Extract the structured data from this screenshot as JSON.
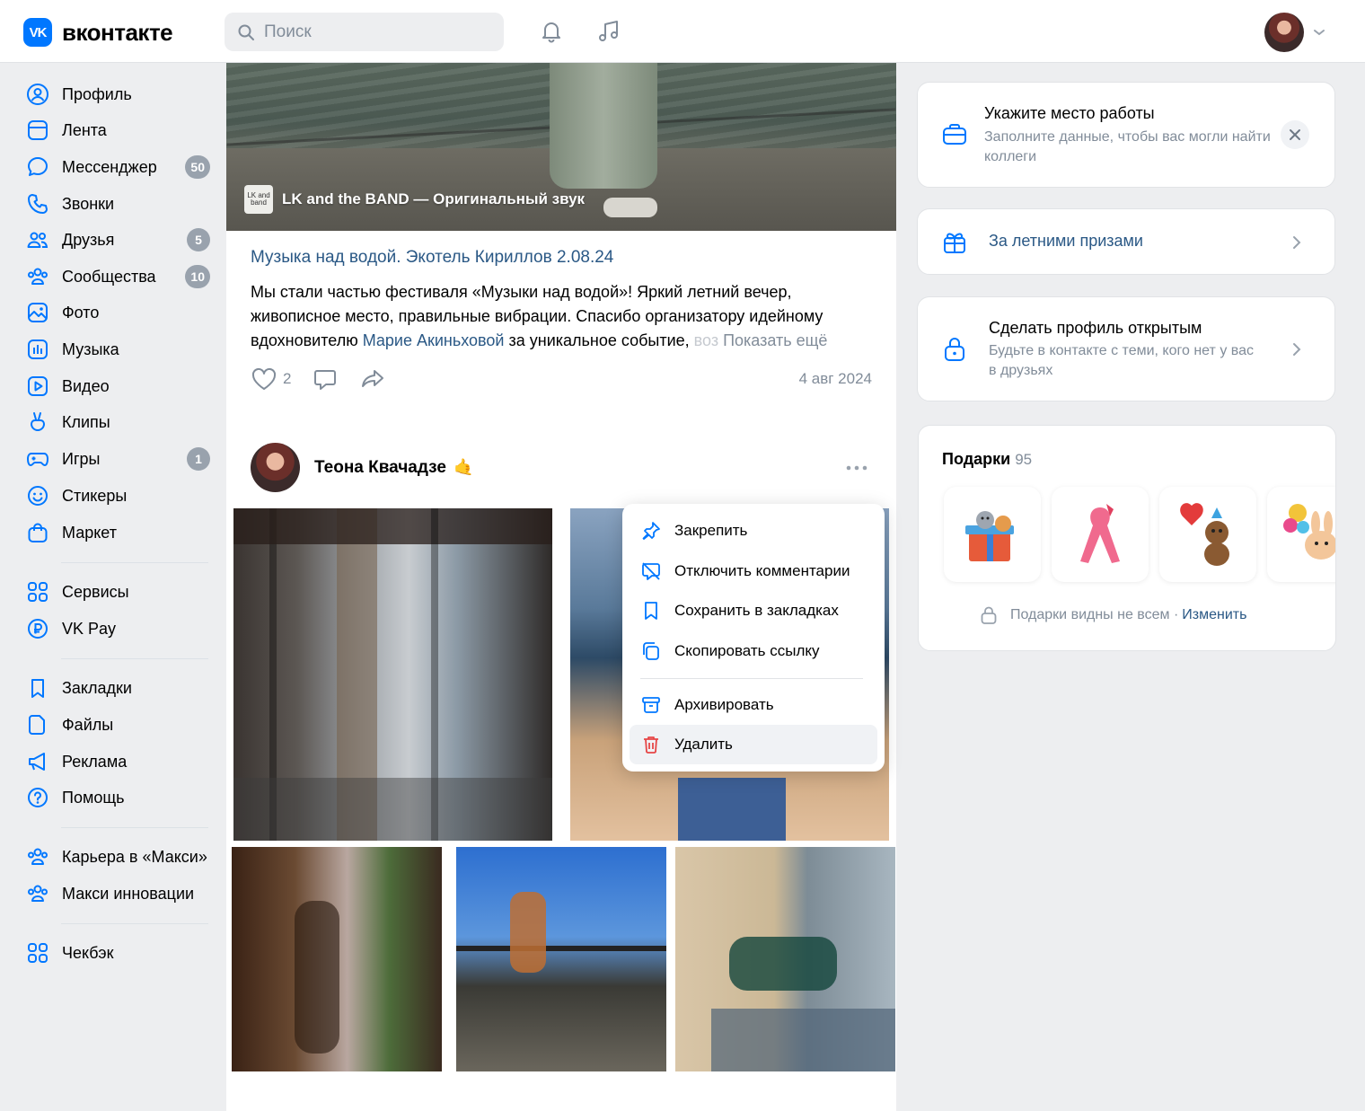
{
  "header": {
    "logo_mark": "VK",
    "logo_text": "вконтакте",
    "search_placeholder": "Поиск"
  },
  "nav": {
    "items": [
      {
        "label": "Профиль",
        "icon": "user-circle-icon"
      },
      {
        "label": "Лента",
        "icon": "feed-icon"
      },
      {
        "label": "Мессенджер",
        "icon": "message-icon",
        "badge": "50"
      },
      {
        "label": "Звонки",
        "icon": "phone-icon"
      },
      {
        "label": "Друзья",
        "icon": "friends-icon",
        "badge": "5"
      },
      {
        "label": "Сообщества",
        "icon": "communities-icon",
        "badge": "10"
      },
      {
        "label": "Фото",
        "icon": "photo-icon"
      },
      {
        "label": "Музыка",
        "icon": "music-icon"
      },
      {
        "label": "Видео",
        "icon": "video-icon"
      },
      {
        "label": "Клипы",
        "icon": "clips-icon"
      },
      {
        "label": "Игры",
        "icon": "gamepad-icon",
        "badge": "1"
      },
      {
        "label": "Стикеры",
        "icon": "smile-icon"
      },
      {
        "label": "Маркет",
        "icon": "bag-icon"
      },
      {
        "label": "Сервисы",
        "icon": "services-icon"
      },
      {
        "label": "VK Pay",
        "icon": "vkpay-icon"
      },
      {
        "label": "Закладки",
        "icon": "bookmark-icon"
      },
      {
        "label": "Файлы",
        "icon": "file-icon"
      },
      {
        "label": "Реклама",
        "icon": "megaphone-icon"
      },
      {
        "label": "Помощь",
        "icon": "help-icon"
      },
      {
        "label": "Карьера в «Макси»",
        "icon": "group-icon"
      },
      {
        "label": "Макси инновации",
        "icon": "group-icon"
      },
      {
        "label": "Чекбэк",
        "icon": "services-icon"
      }
    ]
  },
  "post1": {
    "audio_label": "LK and the BAND — Оригинальный звук",
    "audio_icon_text": "LK and band",
    "title": "Музыка над водой. Экотель Кириллов 2.08.24",
    "text_part1": "Мы стали частью фестиваля «Музыки над водой»! Яркий летний вечер, живописное место, правильные вибрации. Спасибо организатору идейному вдохновителю ",
    "text_link": "Марие Акиньховой",
    "text_part2": " за уникальное событие, ",
    "text_fade": "воз",
    "show_more": " Показать ещё",
    "likes": "2",
    "date": "4 авг 2024"
  },
  "post2": {
    "author": "Теона Квачадзе",
    "emoji": "🤙"
  },
  "context_menu": {
    "items": [
      {
        "label": "Закрепить",
        "icon": "pin-icon"
      },
      {
        "label": "Отключить комментарии",
        "icon": "comment-off-icon"
      },
      {
        "label": "Сохранить в закладках",
        "icon": "bookmark-icon"
      },
      {
        "label": "Скопировать ссылку",
        "icon": "copy-icon"
      },
      {
        "label": "Архивировать",
        "icon": "archive-icon"
      },
      {
        "label": "Удалить",
        "icon": "trash-icon"
      }
    ]
  },
  "right": {
    "work_card": {
      "title": "Укажите место работы",
      "subtitle": "Заполните данные, чтобы вас могли найти коллеги"
    },
    "prizes_card": {
      "title": "За летними призами"
    },
    "open_profile_card": {
      "title": "Сделать профиль открытым",
      "subtitle": "Будьте в контакте с теми, кого нет у вас в друзьях"
    },
    "gifts_card": {
      "title": "Подарки",
      "count": "95",
      "privacy_text": "Подарки видны не всем · ",
      "change_link": "Изменить"
    }
  },
  "colors": {
    "accent": "#0077ff",
    "link": "#2a5885",
    "secondary_text": "#818c99",
    "badge": "#99a2ad",
    "danger": "#e64646"
  }
}
